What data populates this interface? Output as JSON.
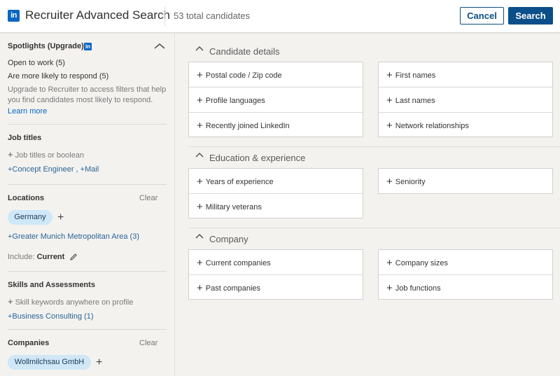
{
  "header": {
    "logo_text": "in",
    "title": "Recruiter Advanced Search",
    "total": "53 total candidates",
    "cancel_label": "Cancel",
    "search_label": "Search"
  },
  "sidebar": {
    "spotlights": {
      "title": "Spotlights (Upgrade)",
      "badge": "in",
      "items": [
        "Open to work (5)",
        "Are more likely to respond (5)"
      ],
      "upgrade_text_1": "Upgrade to Recruiter to access filters that help",
      "upgrade_text_2": "you find candidates most likely to respond.",
      "learn_more": "Learn more"
    },
    "job_titles": {
      "title": "Job titles",
      "placeholder": "Job titles or boolean",
      "suggestions": "+Concept Engineer , +Mail"
    },
    "locations": {
      "title": "Locations",
      "clear": "Clear",
      "selected": "Germany",
      "suggestion": "+Greater Munich Metropolitan Area (3)",
      "include_label": "Include:",
      "include_value": "Current"
    },
    "skills": {
      "title": "Skills and Assessments",
      "placeholder": "Skill keywords anywhere on profile",
      "suggestion": "+Business Consulting (1)"
    },
    "companies": {
      "title": "Companies",
      "clear": "Clear",
      "selected": "Wollmilchsau GmbH"
    }
  },
  "main": {
    "candidate_details": {
      "title": "Candidate details",
      "left": [
        "Postal code / Zip code",
        "Profile languages",
        "Recently joined LinkedIn"
      ],
      "right": [
        "First names",
        "Last names",
        "Network relationships"
      ]
    },
    "education": {
      "title": "Education & experience",
      "left": [
        "Years of experience",
        "Military veterans"
      ],
      "right": [
        "Seniority"
      ]
    },
    "company": {
      "title": "Company",
      "left": [
        "Current companies",
        "Past companies"
      ],
      "right": [
        "Company sizes",
        "Job functions"
      ]
    }
  },
  "colors": {
    "brand": "#0a66c2",
    "button_primary": "#0b4f8a",
    "pill": "#cfe7f7"
  }
}
